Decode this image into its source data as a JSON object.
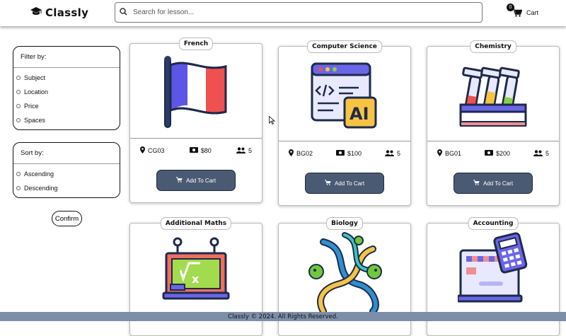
{
  "header": {
    "logo_text": "Classly",
    "search_placeholder": "Search for lesson...",
    "cart_label": "Cart",
    "cart_count": "0"
  },
  "filter": {
    "title": "Filter by:",
    "options": [
      "Subject",
      "Location",
      "Price",
      "Spaces"
    ]
  },
  "sort": {
    "title": "Sort by:",
    "options": [
      "Ascending",
      "Descending"
    ]
  },
  "confirm_label": "Confirm",
  "lessons": [
    {
      "subject": "French",
      "location": "CG03",
      "price": "$80",
      "spaces": "5",
      "icon": "france-flag-icon",
      "button": "Add To Cart"
    },
    {
      "subject": "Computer Science",
      "location": "BG02",
      "price": "$100",
      "spaces": "5",
      "icon": "ai-computer-icon",
      "button": "Add To Cart"
    },
    {
      "subject": "Chemistry",
      "location": "BG01",
      "price": "$200",
      "spaces": "5",
      "icon": "test-tubes-icon",
      "button": "Add To Cart"
    },
    {
      "subject": "Additional Maths",
      "icon": "math-board-icon"
    },
    {
      "subject": "Biology",
      "icon": "dna-icon"
    },
    {
      "subject": "Accounting",
      "icon": "calculator-laptop-icon"
    }
  ],
  "footer_text": "Classly © 2024. All Rights Reserved.",
  "colors": {
    "button": "#4a5a73",
    "footer": "#7d8ea8"
  }
}
